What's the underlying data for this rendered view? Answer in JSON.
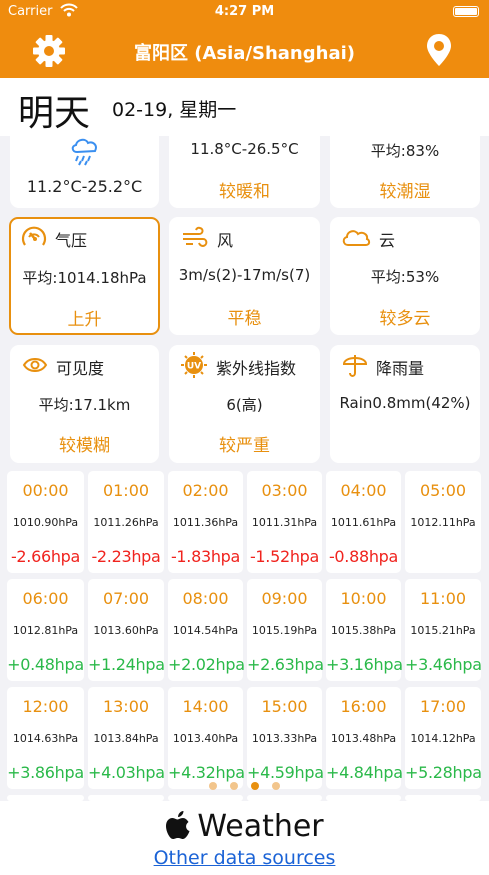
{
  "status": {
    "carrier": "Carrier",
    "time": "4:27 PM"
  },
  "nav": {
    "title": "富阳区 (Asia/Shanghai)",
    "left_icon": "gear-icon",
    "right_icon": "location-pin-icon"
  },
  "day": {
    "label": "明天",
    "date": "02-19, 星期一"
  },
  "top_cards": [
    {
      "value": "11.2°C-25.2°C",
      "icon": "rain-cloud-icon"
    },
    {
      "value": "11.8°C-26.5°C",
      "desc": "较暖和"
    },
    {
      "value": "平均:83%",
      "desc": "较潮湿"
    }
  ],
  "cards_row2": [
    {
      "title": "气压",
      "value": "平均:1014.18hPa",
      "desc": "上升",
      "icon": "gauge-icon"
    },
    {
      "title": "风",
      "value": "3m/s(2)-17m/s(7)",
      "desc": "平稳",
      "icon": "wind-icon"
    },
    {
      "title": "云",
      "value": "平均:53%",
      "desc": "较多云",
      "icon": "cloud-icon"
    }
  ],
  "cards_row3": [
    {
      "title": "可见度",
      "value": "平均:17.1km",
      "desc": "较模糊",
      "icon": "eye-icon"
    },
    {
      "title": "紫外线指数",
      "value": "6(高)",
      "desc": "较严重",
      "icon": "uv-icon"
    },
    {
      "title": "降雨量",
      "value": "Rain0.8mm(42%)",
      "desc": "",
      "icon": "umbrella-icon"
    }
  ],
  "hours": [
    {
      "time": "00:00",
      "pressure": "1010.90hPa",
      "delta": "-2.66hpa",
      "sign": "neg"
    },
    {
      "time": "01:00",
      "pressure": "1011.26hPa",
      "delta": "-2.23hpa",
      "sign": "neg"
    },
    {
      "time": "02:00",
      "pressure": "1011.36hPa",
      "delta": "-1.83hpa",
      "sign": "neg"
    },
    {
      "time": "03:00",
      "pressure": "1011.31hPa",
      "delta": "-1.52hpa",
      "sign": "neg"
    },
    {
      "time": "04:00",
      "pressure": "1011.61hPa",
      "delta": "-0.88hpa",
      "sign": "neg"
    },
    {
      "time": "05:00",
      "pressure": "1012.11hPa",
      "delta": "",
      "sign": "neg"
    },
    {
      "time": "06:00",
      "pressure": "1012.81hPa",
      "delta": "+0.48hpa",
      "sign": "pos"
    },
    {
      "time": "07:00",
      "pressure": "1013.60hPa",
      "delta": "+1.24hpa",
      "sign": "pos"
    },
    {
      "time": "08:00",
      "pressure": "1014.54hPa",
      "delta": "+2.02hpa",
      "sign": "pos"
    },
    {
      "time": "09:00",
      "pressure": "1015.19hPa",
      "delta": "+2.63hpa",
      "sign": "pos"
    },
    {
      "time": "10:00",
      "pressure": "1015.38hPa",
      "delta": "+3.16hpa",
      "sign": "pos"
    },
    {
      "time": "11:00",
      "pressure": "1015.21hPa",
      "delta": "+3.46hpa",
      "sign": "pos"
    },
    {
      "time": "12:00",
      "pressure": "1014.63hPa",
      "delta": "+3.86hpa",
      "sign": "pos"
    },
    {
      "time": "13:00",
      "pressure": "1013.84hPa",
      "delta": "+4.03hpa",
      "sign": "pos"
    },
    {
      "time": "14:00",
      "pressure": "1013.40hPa",
      "delta": "+4.32hpa",
      "sign": "pos"
    },
    {
      "time": "15:00",
      "pressure": "1013.33hPa",
      "delta": "+4.59hpa",
      "sign": "pos"
    },
    {
      "time": "16:00",
      "pressure": "1013.48hPa",
      "delta": "+4.84hpa",
      "sign": "pos"
    },
    {
      "time": "17:00",
      "pressure": "1014.12hPa",
      "delta": "+5.28hpa",
      "sign": "pos"
    }
  ],
  "pager": {
    "count": 4,
    "active": 3
  },
  "footer": {
    "brand": "Weather",
    "link": "Other data sources"
  },
  "colors": {
    "accent": "#ef8c0e",
    "negative": "#f0231e",
    "positive": "#2bb94a",
    "link": "#1b63d6"
  }
}
